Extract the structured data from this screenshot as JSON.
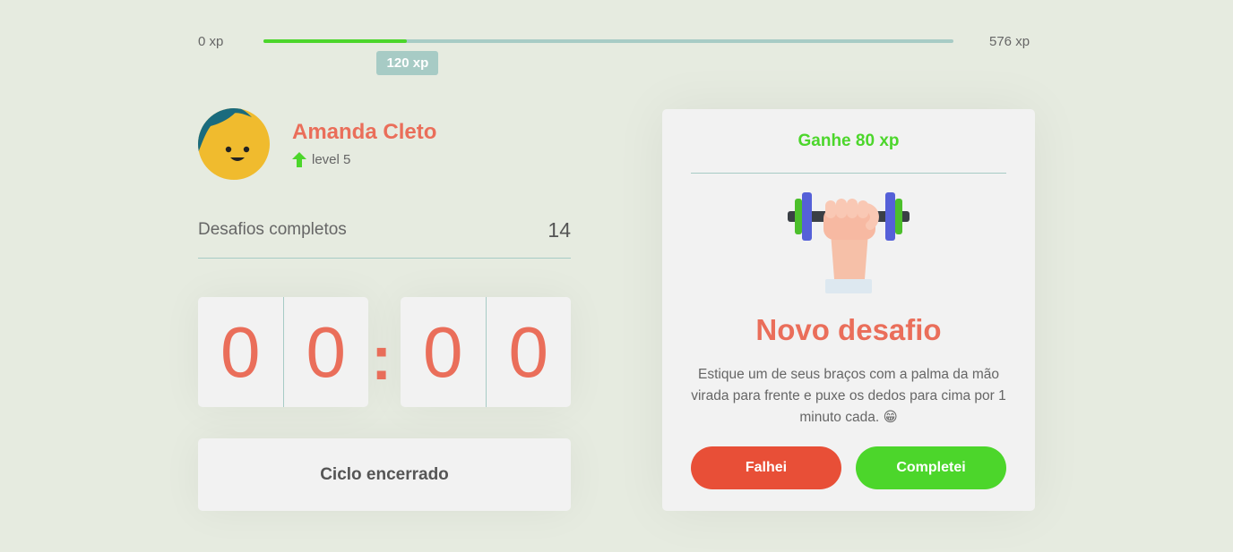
{
  "experience": {
    "min_label": "0 xp",
    "max_label": "576 xp",
    "current_label": "120 xp",
    "current": 120,
    "max": 576,
    "bar_color": "#4cd62b",
    "track_color": "#a7cbc5"
  },
  "profile": {
    "name": "Amanda Cleto",
    "level_label": "level 5",
    "level_icon": "arrow-up-icon"
  },
  "stats": {
    "challenges_label": "Desafios completos",
    "challenges_count": "14"
  },
  "countdown": {
    "minute_left": "0",
    "minute_right": "0",
    "separator": ":",
    "second_left": "0",
    "second_right": "0"
  },
  "cycle_button": {
    "label": "Ciclo encerrado"
  },
  "challenge": {
    "reward_label": "Ganhe 80 xp",
    "icon": "dumbbell-icon",
    "title": "Novo desafio",
    "description": "Estique um de seus braços com a palma da mão virada para frente e puxe os dedos para cima por 1 minuto cada. 😁",
    "fail_label": "Falhei",
    "complete_label": "Completei"
  },
  "colors": {
    "background": "#e6ebe0",
    "accent_red": "#ea6e5a",
    "success_green": "#4cd62b",
    "fail_red": "#e84f37",
    "divider": "#a7cbc5"
  }
}
